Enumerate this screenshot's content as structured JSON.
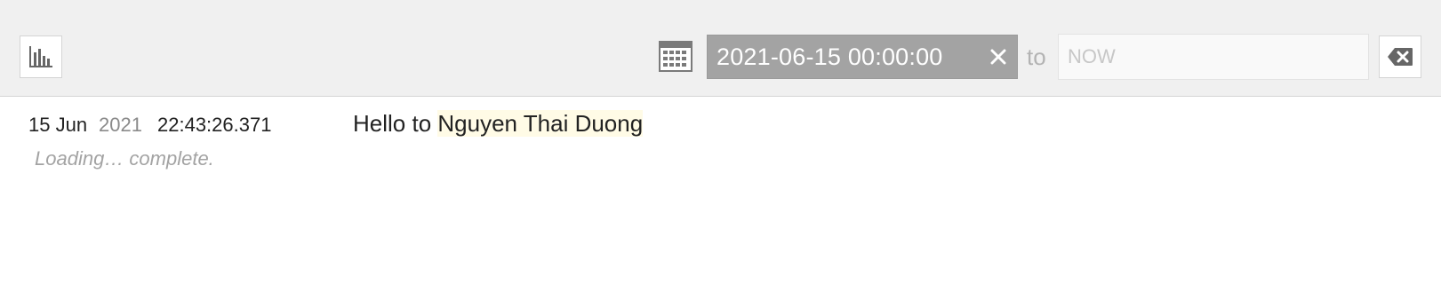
{
  "toolbar": {
    "histogram_icon": "bar-chart-icon",
    "calendar_icon": "calendar-grid-icon",
    "from_value": "2021-06-15 00:00:00",
    "from_clear_icon": "close-icon",
    "to_label": "to",
    "to_placeholder": "NOW",
    "clear_range_icon": "backspace-icon"
  },
  "log": {
    "entry": {
      "date": "15 Jun",
      "year": "2021",
      "time": "22:43:26.371",
      "message_prefix": "Hello to ",
      "message_name": "Nguyen Thai Duong"
    },
    "status": "Loading… complete."
  },
  "colors": {
    "toolbar_bg": "#f0f0f0",
    "from_field_bg": "#a3a3a3",
    "highlight": "#fffbe6"
  }
}
